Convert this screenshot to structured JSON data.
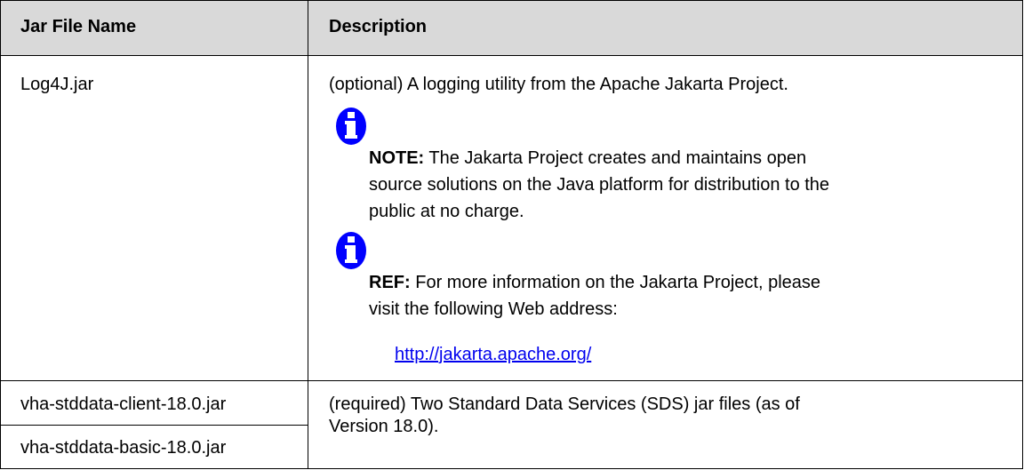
{
  "headers": {
    "col1": "Jar File Name",
    "col2": "Description"
  },
  "rows": [
    {
      "name": "Log4J.jar",
      "description": "(optional) A logging utility from the Apache Jakarta Project.",
      "note": {
        "label": "NOTE:",
        "line1": " The Jakarta Project creates and maintains open",
        "line2": "source solutions on the Java platform for distribution to the",
        "line3": "public at no charge."
      },
      "ref": {
        "label": "REF:",
        "line1": " For more information on the Jakarta Project, please",
        "line2": "visit the following Web address:",
        "link": "http://jakarta.apache.org/"
      }
    },
    {
      "name_a": "vha-stddata-client-18.0.jar",
      "name_b": "vha-stddata-basic-18.0.jar",
      "description_line1": "(required) Two Standard Data Services (SDS) jar files (as of",
      "description_line2": "Version 18.0)."
    }
  ],
  "colors": {
    "header_bg": "#d9d9d9",
    "icon_blue": "#0000ff",
    "link": "#0000ee"
  },
  "icons": [
    "info-icon",
    "info-icon"
  ]
}
